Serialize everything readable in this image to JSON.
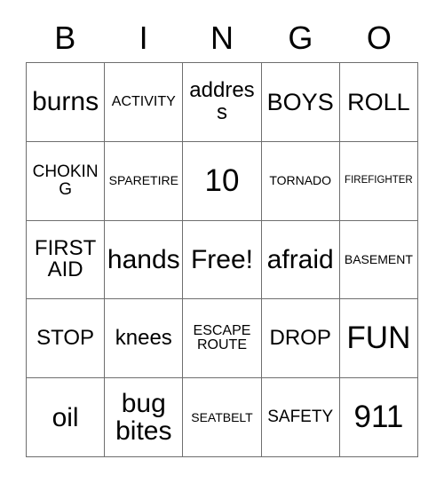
{
  "card": {
    "title_letters": [
      "B",
      "I",
      "N",
      "G",
      "O"
    ],
    "free_space_label": "Free!",
    "rows": [
      [
        {
          "label": "burns",
          "size": "xl"
        },
        {
          "label": "ACTIVITY",
          "size": "xs"
        },
        {
          "label": "address",
          "size": "md"
        },
        {
          "label": "BOYS",
          "size": "lg"
        },
        {
          "label": "ROLL",
          "size": "lg"
        }
      ],
      [
        {
          "label": "CHOKING",
          "size": "sm"
        },
        {
          "label": "SPARETIRE",
          "size": "xxs"
        },
        {
          "label": "10",
          "size": "xxl"
        },
        {
          "label": "TORNADO",
          "size": "xxs"
        },
        {
          "label": "FIREFIGHTER",
          "size": "tiny"
        }
      ],
      [
        {
          "label": "FIRST\nAID",
          "size": "md"
        },
        {
          "label": "hands",
          "size": "xl"
        },
        {
          "label": "Free!",
          "size": "xl"
        },
        {
          "label": "afraid",
          "size": "xl"
        },
        {
          "label": "BASEMENT",
          "size": "xxs"
        }
      ],
      [
        {
          "label": "STOP",
          "size": "md"
        },
        {
          "label": "knees",
          "size": "md"
        },
        {
          "label": "ESCAPE\nROUTE",
          "size": "xs"
        },
        {
          "label": "DROP",
          "size": "md"
        },
        {
          "label": "FUN",
          "size": "xxl"
        }
      ],
      [
        {
          "label": "oil",
          "size": "xl"
        },
        {
          "label": "bug\nbites",
          "size": "xl"
        },
        {
          "label": "SEATBELT",
          "size": "xxs"
        },
        {
          "label": "SAFETY",
          "size": "sm"
        },
        {
          "label": "911",
          "size": "xxl"
        }
      ]
    ]
  },
  "colors": {
    "grid_line": "#6e6e6e",
    "text": "#000000",
    "background": "#ffffff"
  }
}
